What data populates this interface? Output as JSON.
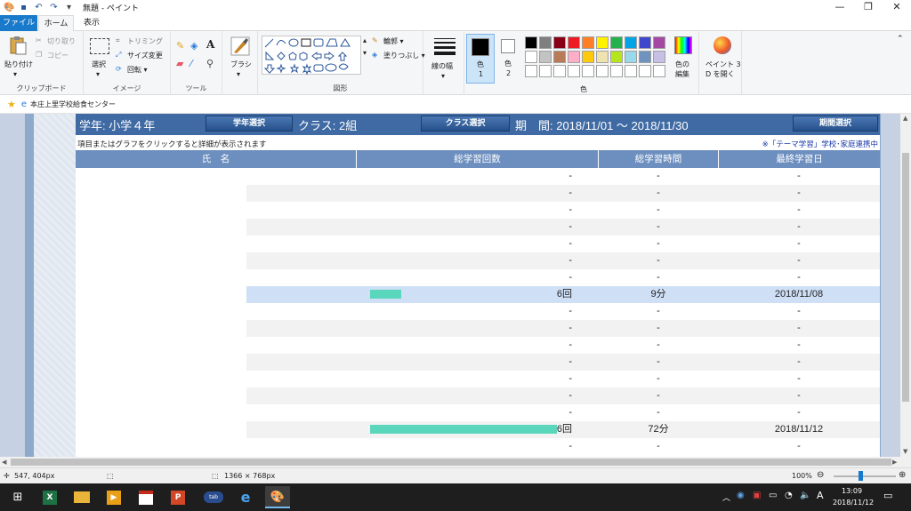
{
  "window": {
    "title": "無題 - ペイント",
    "minimize": "—",
    "maximize": "❐",
    "close": "✕"
  },
  "tabs": {
    "file": "ファイル",
    "home": "ホーム",
    "view": "表示"
  },
  "ribbon": {
    "clipboard": {
      "paste": "貼り付け",
      "cut": "切り取り",
      "copy": "コピー",
      "label": "クリップボード"
    },
    "image": {
      "select": "選択",
      "crop": "トリミング",
      "resize": "サイズ変更",
      "rotate": "回転",
      "label": "イメージ"
    },
    "tools": {
      "label": "ツール",
      "text": "A"
    },
    "brush": {
      "label": "ブラシ"
    },
    "shapes": {
      "outline": "輪郭",
      "fill": "塗りつぶし",
      "label": "図形"
    },
    "size": {
      "label": "線の幅"
    },
    "color1": {
      "line1": "色",
      "line2": "1"
    },
    "color2": {
      "line1": "色",
      "line2": "2"
    },
    "colors_label": "色",
    "edit_colors": {
      "line1": "色の",
      "line2": "編集"
    },
    "paint3d": {
      "line1": "ペイント 3",
      "line2": "D を開く"
    },
    "palette": [
      "#000000",
      "#7f7f7f",
      "#880015",
      "#ed1c24",
      "#ff7f27",
      "#fff200",
      "#22b14c",
      "#00a2e8",
      "#3f48cc",
      "#a349a4",
      "#ffffff",
      "#c3c3c3",
      "#b97a57",
      "#ffaec9",
      "#ffc90e",
      "#efe4b0",
      "#b5e61d",
      "#99d9ea",
      "#7092be",
      "#c8bfe7",
      "#ffffff",
      "#ffffff",
      "#ffffff",
      "#ffffff",
      "#ffffff",
      "#ffffff",
      "#ffffff",
      "#ffffff",
      "#ffffff",
      "#ffffff"
    ]
  },
  "address": {
    "text": "本庄上里学校給食センター"
  },
  "report": {
    "grade_label": "学年: 小学４年",
    "grade_button": "学年選択",
    "class_label": "クラス: 2組",
    "class_button": "クラス選択",
    "period_label": "期　間: 2018/11/01 ～ 2018/11/30",
    "period_button": "期間選択",
    "hint": "項目またはグラフをクリックすると詳細が表示されます",
    "note": "※「テーマ学習」学校･家庭連携中",
    "columns": [
      "氏　名",
      "総学習回数",
      "総学習時間",
      "最終学習日"
    ],
    "rows": [
      {
        "count": "-",
        "time": "-",
        "date": "-",
        "bar": 0
      },
      {
        "count": "-",
        "time": "-",
        "date": "-",
        "bar": 0
      },
      {
        "count": "-",
        "time": "-",
        "date": "-",
        "bar": 0
      },
      {
        "count": "-",
        "time": "-",
        "date": "-",
        "bar": 0
      },
      {
        "count": "-",
        "time": "-",
        "date": "-",
        "bar": 0
      },
      {
        "count": "-",
        "time": "-",
        "date": "-",
        "bar": 0
      },
      {
        "count": "-",
        "time": "-",
        "date": "-",
        "bar": 0
      },
      {
        "count": "6回",
        "time": "9分",
        "date": "2018/11/08",
        "bar": 6,
        "highlight": true
      },
      {
        "count": "-",
        "time": "-",
        "date": "-",
        "bar": 0
      },
      {
        "count": "-",
        "time": "-",
        "date": "-",
        "bar": 0
      },
      {
        "count": "-",
        "time": "-",
        "date": "-",
        "bar": 0
      },
      {
        "count": "-",
        "time": "-",
        "date": "-",
        "bar": 0
      },
      {
        "count": "-",
        "time": "-",
        "date": "-",
        "bar": 0
      },
      {
        "count": "-",
        "time": "-",
        "date": "-",
        "bar": 0
      },
      {
        "count": "-",
        "time": "-",
        "date": "-",
        "bar": 0
      },
      {
        "count": "36回",
        "time": "72分",
        "date": "2018/11/12",
        "bar": 36
      },
      {
        "count": "-",
        "time": "-",
        "date": "-",
        "bar": 0
      }
    ]
  },
  "status": {
    "cursor": "547, 404px",
    "canvas_size": "1366 × 768px",
    "zoom": "100%",
    "zoom_level": 100
  },
  "taskbar": {
    "time": "13:09",
    "date": "2018/11/12",
    "ime": "A"
  }
}
